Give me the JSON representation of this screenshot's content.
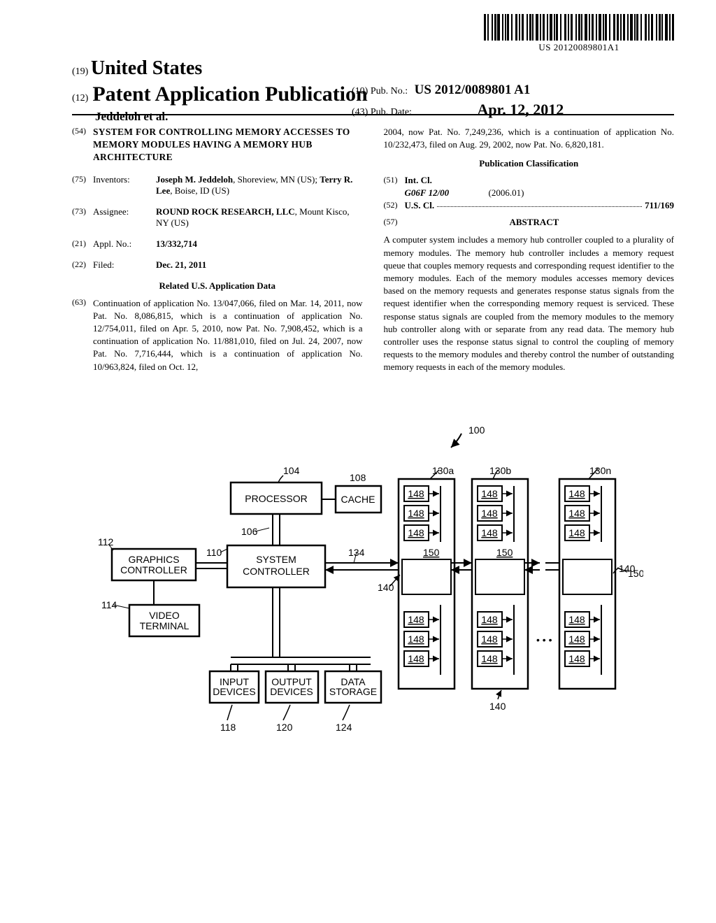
{
  "barcode_text": "US 20120089801A1",
  "header": {
    "country_num": "(19)",
    "country": "United States",
    "pub_num": "(12)",
    "pub_type": "Patent Application Publication",
    "authors": "Jeddeloh et al.",
    "pubno_num": "(10)",
    "pubno_label": "Pub. No.:",
    "pubno_value": "US 2012/0089801 A1",
    "pubdate_num": "(43)",
    "pubdate_label": "Pub. Date:",
    "pubdate_value": "Apr. 12, 2012"
  },
  "left": {
    "title_num": "(54)",
    "title": "SYSTEM FOR CONTROLLING MEMORY ACCESSES TO MEMORY MODULES HAVING A MEMORY HUB ARCHITECTURE",
    "inventors_num": "(75)",
    "inventors_label": "Inventors:",
    "inventors_value_1": "Joseph M. Jeddeloh",
    "inventors_value_2": ", Shoreview, MN (US); ",
    "inventors_value_3": "Terry R. Lee",
    "inventors_value_4": ", Boise, ID (US)",
    "assignee_num": "(73)",
    "assignee_label": "Assignee:",
    "assignee_value_1": "ROUND ROCK RESEARCH, LLC",
    "assignee_value_2": ", Mount Kisco, NY (US)",
    "applno_num": "(21)",
    "applno_label": "Appl. No.:",
    "applno_value": "13/332,714",
    "filed_num": "(22)",
    "filed_label": "Filed:",
    "filed_value": "Dec. 21, 2011",
    "related_head": "Related U.S. Application Data",
    "related_num": "(63)",
    "related_text": "Continuation of application No. 13/047,066, filed on Mar. 14, 2011, now Pat. No. 8,086,815, which is a continuation of application No. 12/754,011, filed on Apr. 5, 2010, now Pat. No. 7,908,452, which is a continuation of application No. 11/881,010, filed on Jul. 24, 2007, now Pat. No. 7,716,444, which is a continuation of application No. 10/963,824, filed on Oct. 12,"
  },
  "right": {
    "continuation": "2004, now Pat. No. 7,249,236, which is a continuation of application No. 10/232,473, filed on Aug. 29, 2002, now Pat. No. 6,820,181.",
    "class_head": "Publication Classification",
    "intcl_num": "(51)",
    "intcl_label": "Int. Cl.",
    "intcl_code": "G06F 12/00",
    "intcl_date": "(2006.01)",
    "uscl_num": "(52)",
    "uscl_label": "U.S. Cl.",
    "uscl_value": "711/169",
    "abstract_num": "(57)",
    "abstract_head": "ABSTRACT",
    "abstract_text": "A computer system includes a memory hub controller coupled to a plurality of memory modules. The memory hub controller includes a memory request queue that couples memory requests and corresponding request identifier to the memory modules. Each of the memory modules accesses memory devices based on the memory requests and generates response status signals from the request identifier when the corresponding memory request is serviced. These response status signals are coupled from the memory modules to the memory hub controller along with or separate from any read data. The memory hub controller uses the response status signal to control the coupling of memory requests to the memory modules and thereby control the number of outstanding memory requests in each of the memory modules."
  },
  "diagram": {
    "ref_100": "100",
    "processor": "PROCESSOR",
    "processor_ref": "104",
    "cache": "CACHE",
    "cache_ref": "108",
    "sysctrl": "SYSTEM CONTROLLER",
    "sysctrl_ref_106": "106",
    "sysctrl_ref_110": "110",
    "graphics": "GRAPHICS CONTROLLER",
    "graphics_ref": "112",
    "video": "VIDEO TERMINAL",
    "video_ref": "114",
    "input": "INPUT DEVICES",
    "input_ref": "118",
    "output": "OUTPUT DEVICES",
    "output_ref": "120",
    "storage": "DATA STORAGE",
    "storage_ref": "124",
    "bus_ref_134": "134",
    "mod_130a": "130a",
    "mod_130b": "130b",
    "mod_130n": "130n",
    "mem_148": "148",
    "hub_150": "150",
    "hub_140": "140",
    "ellipsis": "• • •"
  }
}
